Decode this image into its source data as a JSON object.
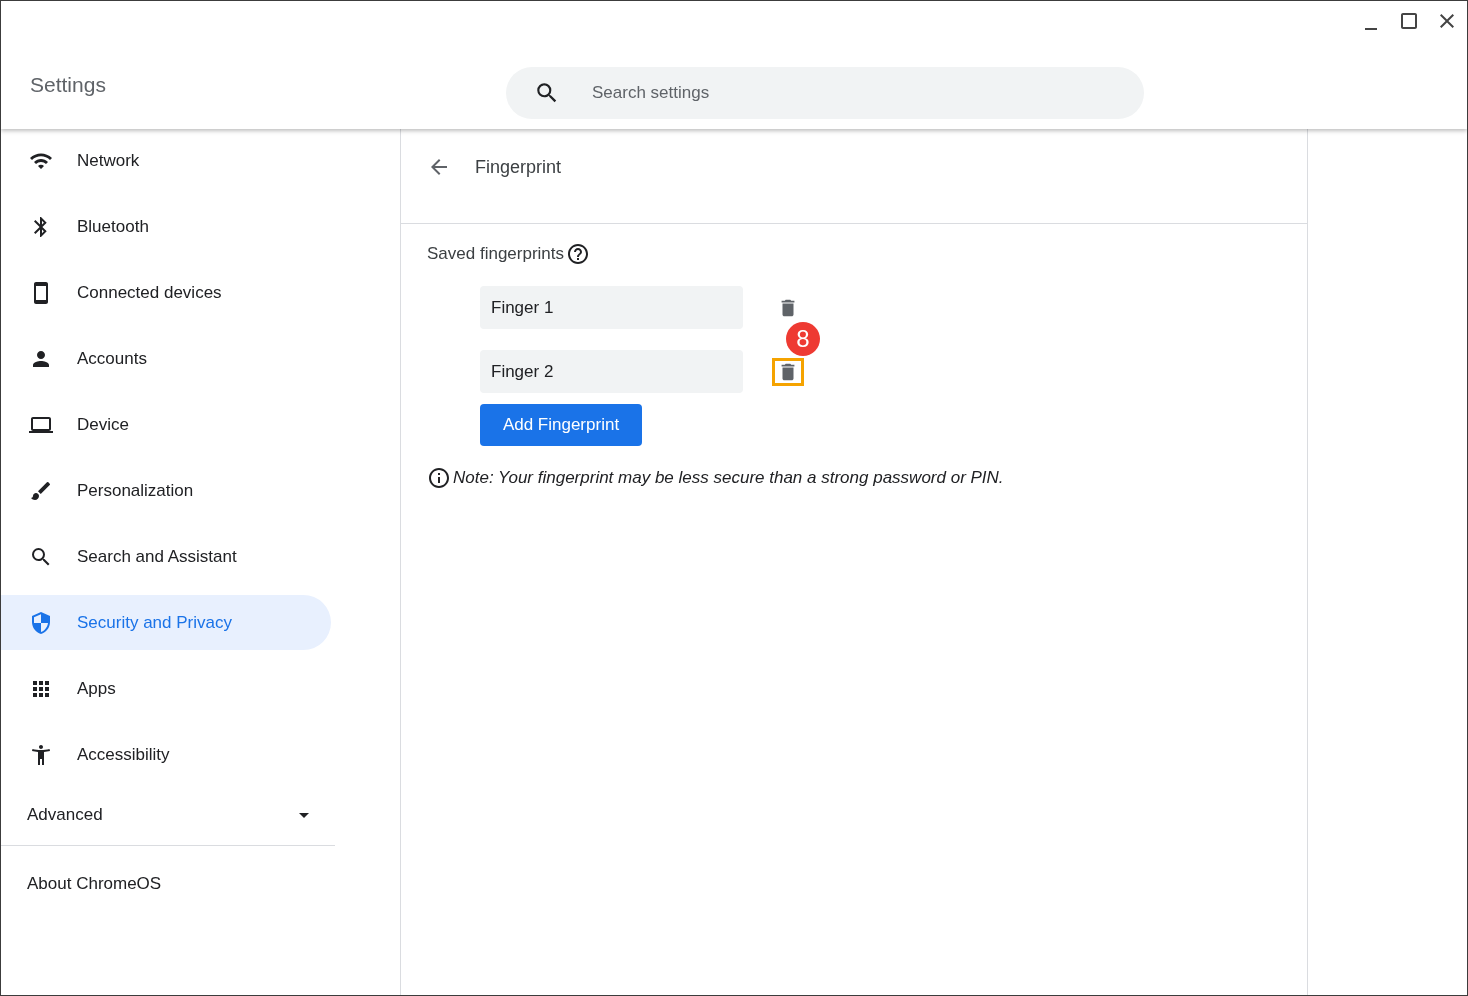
{
  "window": {
    "title": "Settings"
  },
  "search": {
    "placeholder": "Search settings"
  },
  "sidebar": {
    "items": [
      {
        "label": "Network",
        "selected": false
      },
      {
        "label": "Bluetooth",
        "selected": false
      },
      {
        "label": "Connected devices",
        "selected": false
      },
      {
        "label": "Accounts",
        "selected": false
      },
      {
        "label": "Device",
        "selected": false
      },
      {
        "label": "Personalization",
        "selected": false
      },
      {
        "label": "Search and Assistant",
        "selected": false
      },
      {
        "label": "Security and Privacy",
        "selected": true
      },
      {
        "label": "Apps",
        "selected": false
      },
      {
        "label": "Accessibility",
        "selected": false
      }
    ],
    "advanced": {
      "label": "Advanced",
      "expanded": false
    },
    "about": "About ChromeOS"
  },
  "page": {
    "title": "Fingerprint",
    "section_label": "Saved fingerprints",
    "fingerprints": [
      {
        "name": "Finger 1",
        "highlighted": false
      },
      {
        "name": "Finger 2",
        "highlighted": true
      }
    ],
    "add_button": "Add Fingerprint",
    "note": "Note: Your fingerprint may be less secure than a strong password or PIN.",
    "callout": "8"
  }
}
